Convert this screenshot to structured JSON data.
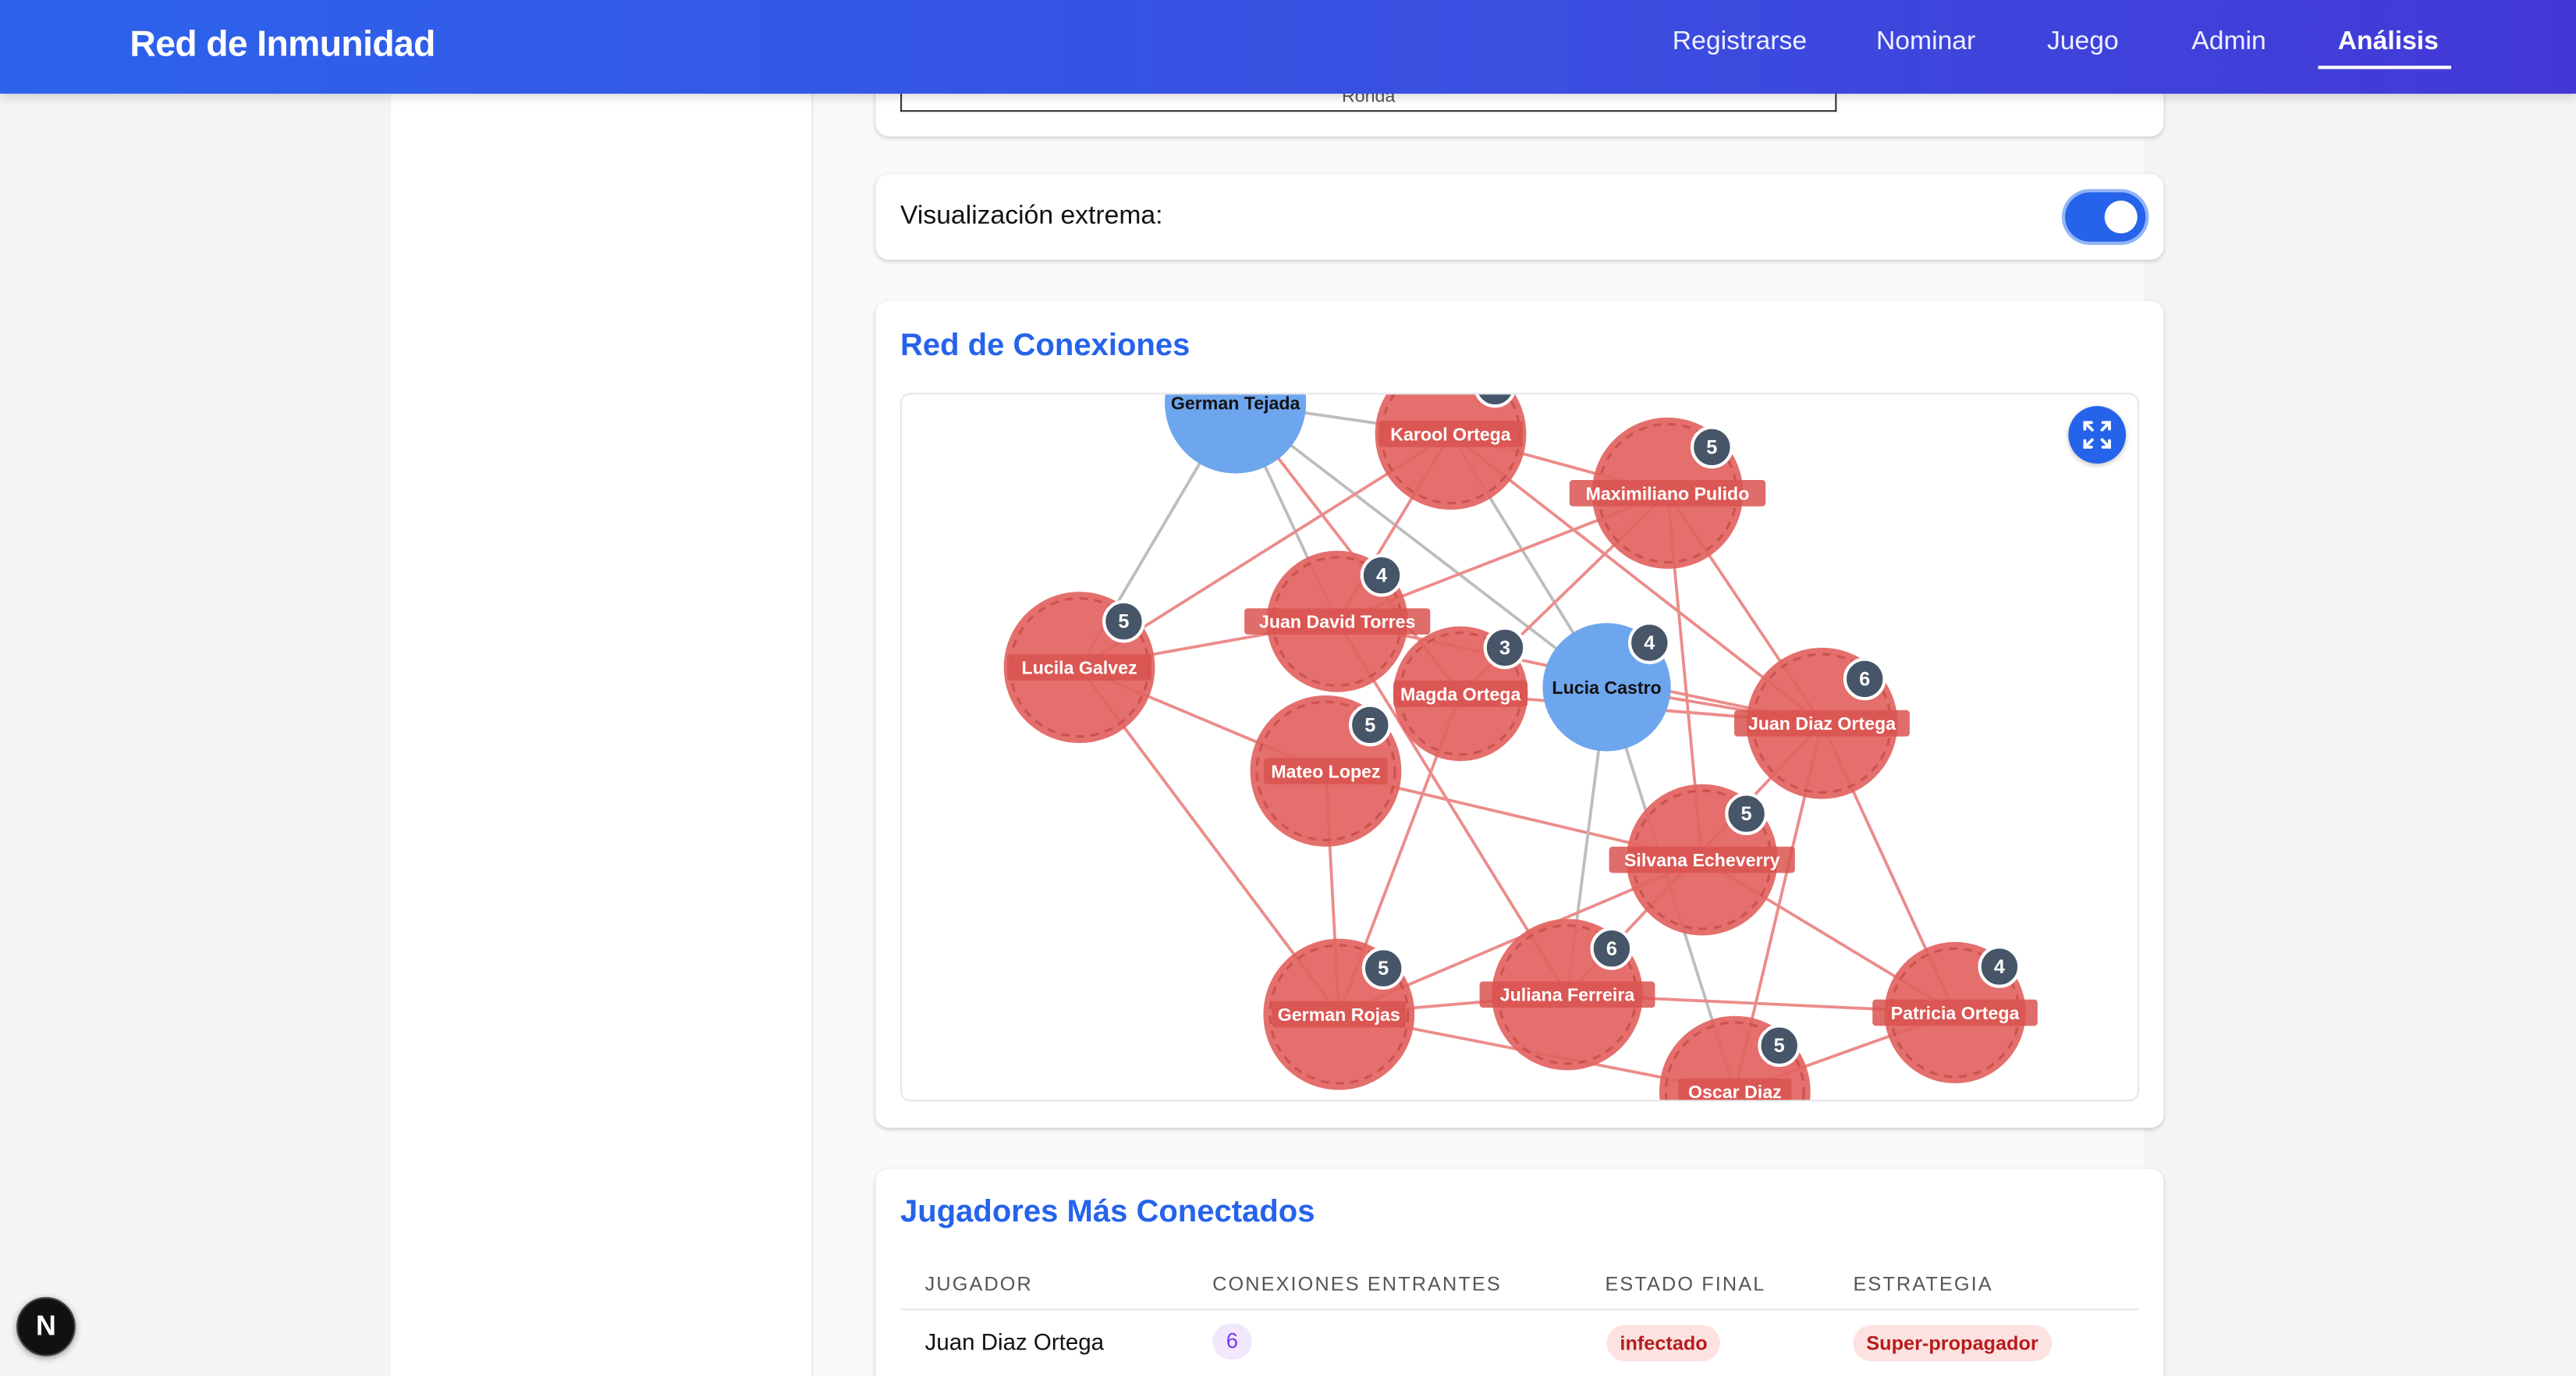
{
  "app": {
    "title": "Red de Inmunidad"
  },
  "nav": {
    "items": [
      {
        "label": "Registrarse"
      },
      {
        "label": "Nominar"
      },
      {
        "label": "Juego"
      },
      {
        "label": "Admin"
      },
      {
        "label": "Análisis"
      }
    ],
    "active": "Análisis"
  },
  "round_chart": {
    "x_axis_label": "Ronda"
  },
  "settings": {
    "extreme_label": "Visualización extrema:",
    "extreme_on": true
  },
  "network": {
    "title": "Red de Conexiones",
    "colors": {
      "infected": "#e2635f",
      "healthy": "#6ea6ee",
      "infected_edge": "#eb8c8a",
      "neutral_edge": "#bdbdbd",
      "badge": "#475569"
    },
    "nodes": [
      {
        "name": "German Tejada",
        "status": "healthy",
        "degree": null
      },
      {
        "name": "Karool Ortega",
        "status": "infected",
        "degree": null
      },
      {
        "name": "Maximiliano Pulido",
        "status": "infected",
        "degree": 5
      },
      {
        "name": "Juan David Torres",
        "status": "infected",
        "degree": 4
      },
      {
        "name": "Lucila Galvez",
        "status": "infected",
        "degree": 5
      },
      {
        "name": "Magda Ortega",
        "status": "infected",
        "degree": 3
      },
      {
        "name": "Lucia Castro",
        "status": "healthy",
        "degree": 4
      },
      {
        "name": "Juan Diaz Ortega",
        "status": "infected",
        "degree": 6
      },
      {
        "name": "Mateo Lopez",
        "status": "infected",
        "degree": 5
      },
      {
        "name": "Silvana Echeverry",
        "status": "infected",
        "degree": 5
      },
      {
        "name": "German Rojas",
        "status": "infected",
        "degree": 5
      },
      {
        "name": "Juliana Ferreira",
        "status": "infected",
        "degree": 6
      },
      {
        "name": "Patricia Ortega",
        "status": "infected",
        "degree": 4
      },
      {
        "name": "Oscar Diaz",
        "status": "infected",
        "degree": 5
      }
    ],
    "edges": [
      [
        "German Tejada",
        "Karool Ortega",
        "neutral"
      ],
      [
        "German Tejada",
        "Lucila Galvez",
        "neutral"
      ],
      [
        "German Tejada",
        "Juan David Torres",
        "neutral"
      ],
      [
        "German Tejada",
        "Lucia Castro",
        "neutral"
      ],
      [
        "German Tejada",
        "Magda Ortega",
        "infected"
      ],
      [
        "Karool Ortega",
        "Lucila Galvez",
        "infected"
      ],
      [
        "Karool Ortega",
        "Maximiliano Pulido",
        "infected"
      ],
      [
        "Karool Ortega",
        "Lucia Castro",
        "neutral"
      ],
      [
        "Karool Ortega",
        "Juan David Torres",
        "infected"
      ],
      [
        "Karool Ortega",
        "Juan Diaz Ortega",
        "infected"
      ],
      [
        "Maximiliano Pulido",
        "Juan David Torres",
        "infected"
      ],
      [
        "Maximiliano Pulido",
        "Juan Diaz Ortega",
        "infected"
      ],
      [
        "Maximiliano Pulido",
        "Silvana Echeverry",
        "infected"
      ],
      [
        "Maximiliano Pulido",
        "Magda Ortega",
        "infected"
      ],
      [
        "Juan David Torres",
        "Lucila Galvez",
        "infected"
      ],
      [
        "Juan David Torres",
        "Juan Diaz Ortega",
        "infected"
      ],
      [
        "Juan David Torres",
        "Juliana Ferreira",
        "infected"
      ],
      [
        "Lucila Galvez",
        "Mateo Lopez",
        "infected"
      ],
      [
        "Lucila Galvez",
        "German Rojas",
        "infected"
      ],
      [
        "Magda Ortega",
        "German Rojas",
        "infected"
      ],
      [
        "Magda Ortega",
        "Juan Diaz Ortega",
        "infected"
      ],
      [
        "Mateo Lopez",
        "Silvana Echeverry",
        "infected"
      ],
      [
        "Mateo Lopez",
        "German Rojas",
        "infected"
      ],
      [
        "Lucia Castro",
        "Juan Diaz Ortega",
        "infected"
      ],
      [
        "Lucia Castro",
        "Juliana Ferreira",
        "neutral"
      ],
      [
        "Lucia Castro",
        "Oscar Diaz",
        "neutral"
      ],
      [
        "Juan Diaz Ortega",
        "Juliana Ferreira",
        "infected"
      ],
      [
        "Juan Diaz Ortega",
        "Patricia Ortega",
        "infected"
      ],
      [
        "Juan Diaz Ortega",
        "Oscar Diaz",
        "infected"
      ],
      [
        "Silvana Echeverry",
        "German Rojas",
        "infected"
      ],
      [
        "Silvana Echeverry",
        "Patricia Ortega",
        "infected"
      ],
      [
        "German Rojas",
        "Juliana Ferreira",
        "infected"
      ],
      [
        "German Rojas",
        "Oscar Diaz",
        "infected"
      ],
      [
        "Juliana Ferreira",
        "Patricia Ortega",
        "infected"
      ],
      [
        "Oscar Diaz",
        "Patricia Ortega",
        "infected"
      ]
    ]
  },
  "top_players": {
    "title": "Jugadores Más Conectados",
    "headers": [
      "JUGADOR",
      "CONEXIONES ENTRANTES",
      "ESTADO FINAL",
      "ESTRATEGIA"
    ],
    "rows": [
      {
        "player": "Juan Diaz Ortega",
        "incoming": "6",
        "final_state": "infectado",
        "strategy": "Super-propagador"
      }
    ]
  },
  "dev": {
    "badge": "N"
  }
}
